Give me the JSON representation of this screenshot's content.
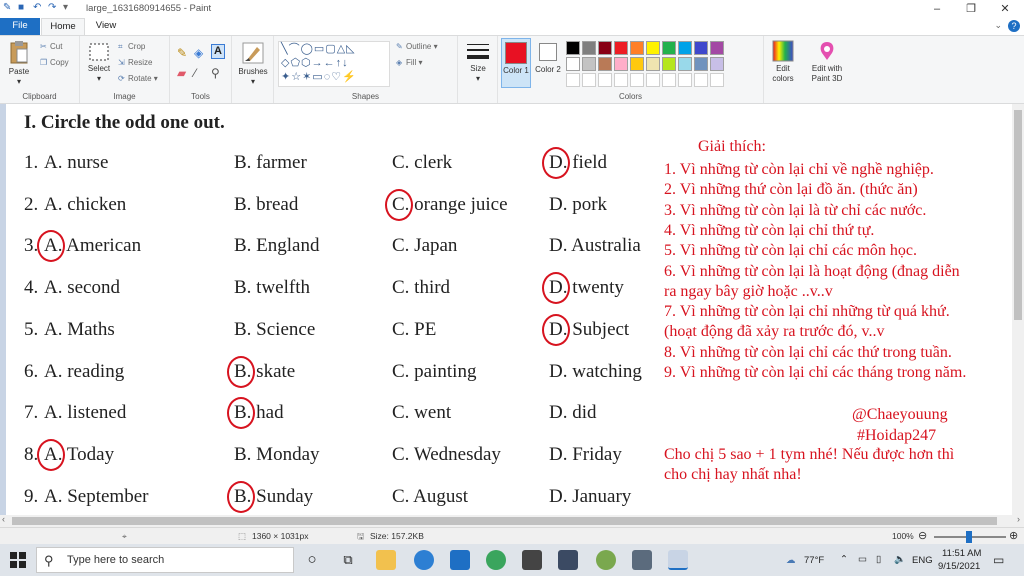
{
  "window": {
    "title": "large_1631680914655 - Paint"
  },
  "tabs": [
    "File",
    "Home",
    "View"
  ],
  "ribbon": {
    "clipboard": {
      "paste": "Paste",
      "cut": "Cut",
      "copy": "Copy",
      "group": "Clipboard"
    },
    "image": {
      "select": "Select",
      "crop": "Crop",
      "resize": "Resize",
      "rotate": "Rotate",
      "group": "Image"
    },
    "tools": {
      "group": "Tools"
    },
    "brushes": {
      "label": "Brushes"
    },
    "shapes": {
      "outline": "Outline",
      "fill": "Fill",
      "group": "Shapes"
    },
    "size": {
      "label": "Size"
    },
    "color1": {
      "label": "Color 1",
      "value": "#e81123"
    },
    "color2": {
      "label": "Color 2",
      "value": "#ffffff"
    },
    "colors": {
      "group": "Colors",
      "row1": [
        "#000000",
        "#7f7f7f",
        "#880015",
        "#ed1c24",
        "#ff7f27",
        "#fff200",
        "#22b14c",
        "#00a2e8",
        "#3f48cc",
        "#a349a4"
      ],
      "row2": [
        "#ffffff",
        "#c3c3c3",
        "#b97a57",
        "#ffaec9",
        "#ffc90e",
        "#efe4b0",
        "#b5e61d",
        "#99d9ea",
        "#7092be",
        "#c8bfe7"
      ]
    },
    "edit_colors": "Edit colors",
    "paint3d": "Edit with Paint 3D"
  },
  "document": {
    "heading": "I. Circle the odd one out.",
    "rows": [
      {
        "n": "1.",
        "a": "A. nurse",
        "b": "B. farmer",
        "c": "C. clerk",
        "d": "D. field",
        "circled": "D"
      },
      {
        "n": "2.",
        "a": "A. chicken",
        "b": "B. bread",
        "c": "C. orange juice",
        "d": "D. pork",
        "circled": "C"
      },
      {
        "n": "3.",
        "a": "A. American",
        "b": "B. England",
        "c": "C. Japan",
        "d": "D. Australia",
        "circled": "A"
      },
      {
        "n": "4.",
        "a": "A. second",
        "b": "B. twelfth",
        "c": "C. third",
        "d": "D. twenty",
        "circled": "D"
      },
      {
        "n": "5.",
        "a": "A. Maths",
        "b": "B. Science",
        "c": "C. PE",
        "d": "D. Subject",
        "circled": "D"
      },
      {
        "n": "6.",
        "a": "A. reading",
        "b": "B. skate",
        "c": "C. painting",
        "d": "D. watching",
        "circled": "B"
      },
      {
        "n": "7.",
        "a": "A. listened",
        "b": "B. had",
        "c": "C. went",
        "d": "D. did",
        "circled": "B"
      },
      {
        "n": "8.",
        "a": "A. Today",
        "b": "B. Monday",
        "c": "C. Wednesday",
        "d": "D. Friday",
        "circled": "A"
      },
      {
        "n": "9.",
        "a": "A. September",
        "b": "B. Sunday",
        "c": "C. August",
        "d": "D. January",
        "circled": "B"
      }
    ],
    "explain_title": "Giải thích:",
    "explain_lines": [
      "1. Vì những từ còn lại chỉ về nghề nghiệp.",
      "2. Vì những thứ còn lại đồ ăn. (thức ăn)",
      "3. Vì những từ còn lại là từ chỉ các nước.",
      "4. Vì những từ còn lại chỉ thứ tự.",
      "5. Vì những từ còn lại chỉ các môn học.",
      "6. Vì những từ còn lại là hoạt động (đnag diễn",
      "ra ngay bây giờ hoặc ..v..v",
      "7. Vì những từ còn lại chỉ những từ quá khứ.",
      "(hoạt động đã xảy ra trước đó, v..v",
      "8. Vì những từ còn lại chỉ các thứ trong tuần.",
      "9. Vì những từ còn lại chỉ các tháng trong năm."
    ],
    "signature": "@Chaeyouung",
    "hashtag": "#Hoidap247",
    "closing1": "Cho chị 5 sao + 1 tym nhé! Nếu được hơn thì",
    "closing2": "cho chị hay nhất nha!"
  },
  "status": {
    "dimensions": "1360 × 1031px",
    "size": "Size: 157.2KB",
    "zoom": "100%"
  },
  "taskbar": {
    "search_placeholder": "Type here to search",
    "weather": "77°F",
    "lang": "ENG",
    "time": "11:51 AM",
    "date": "9/15/2021"
  }
}
